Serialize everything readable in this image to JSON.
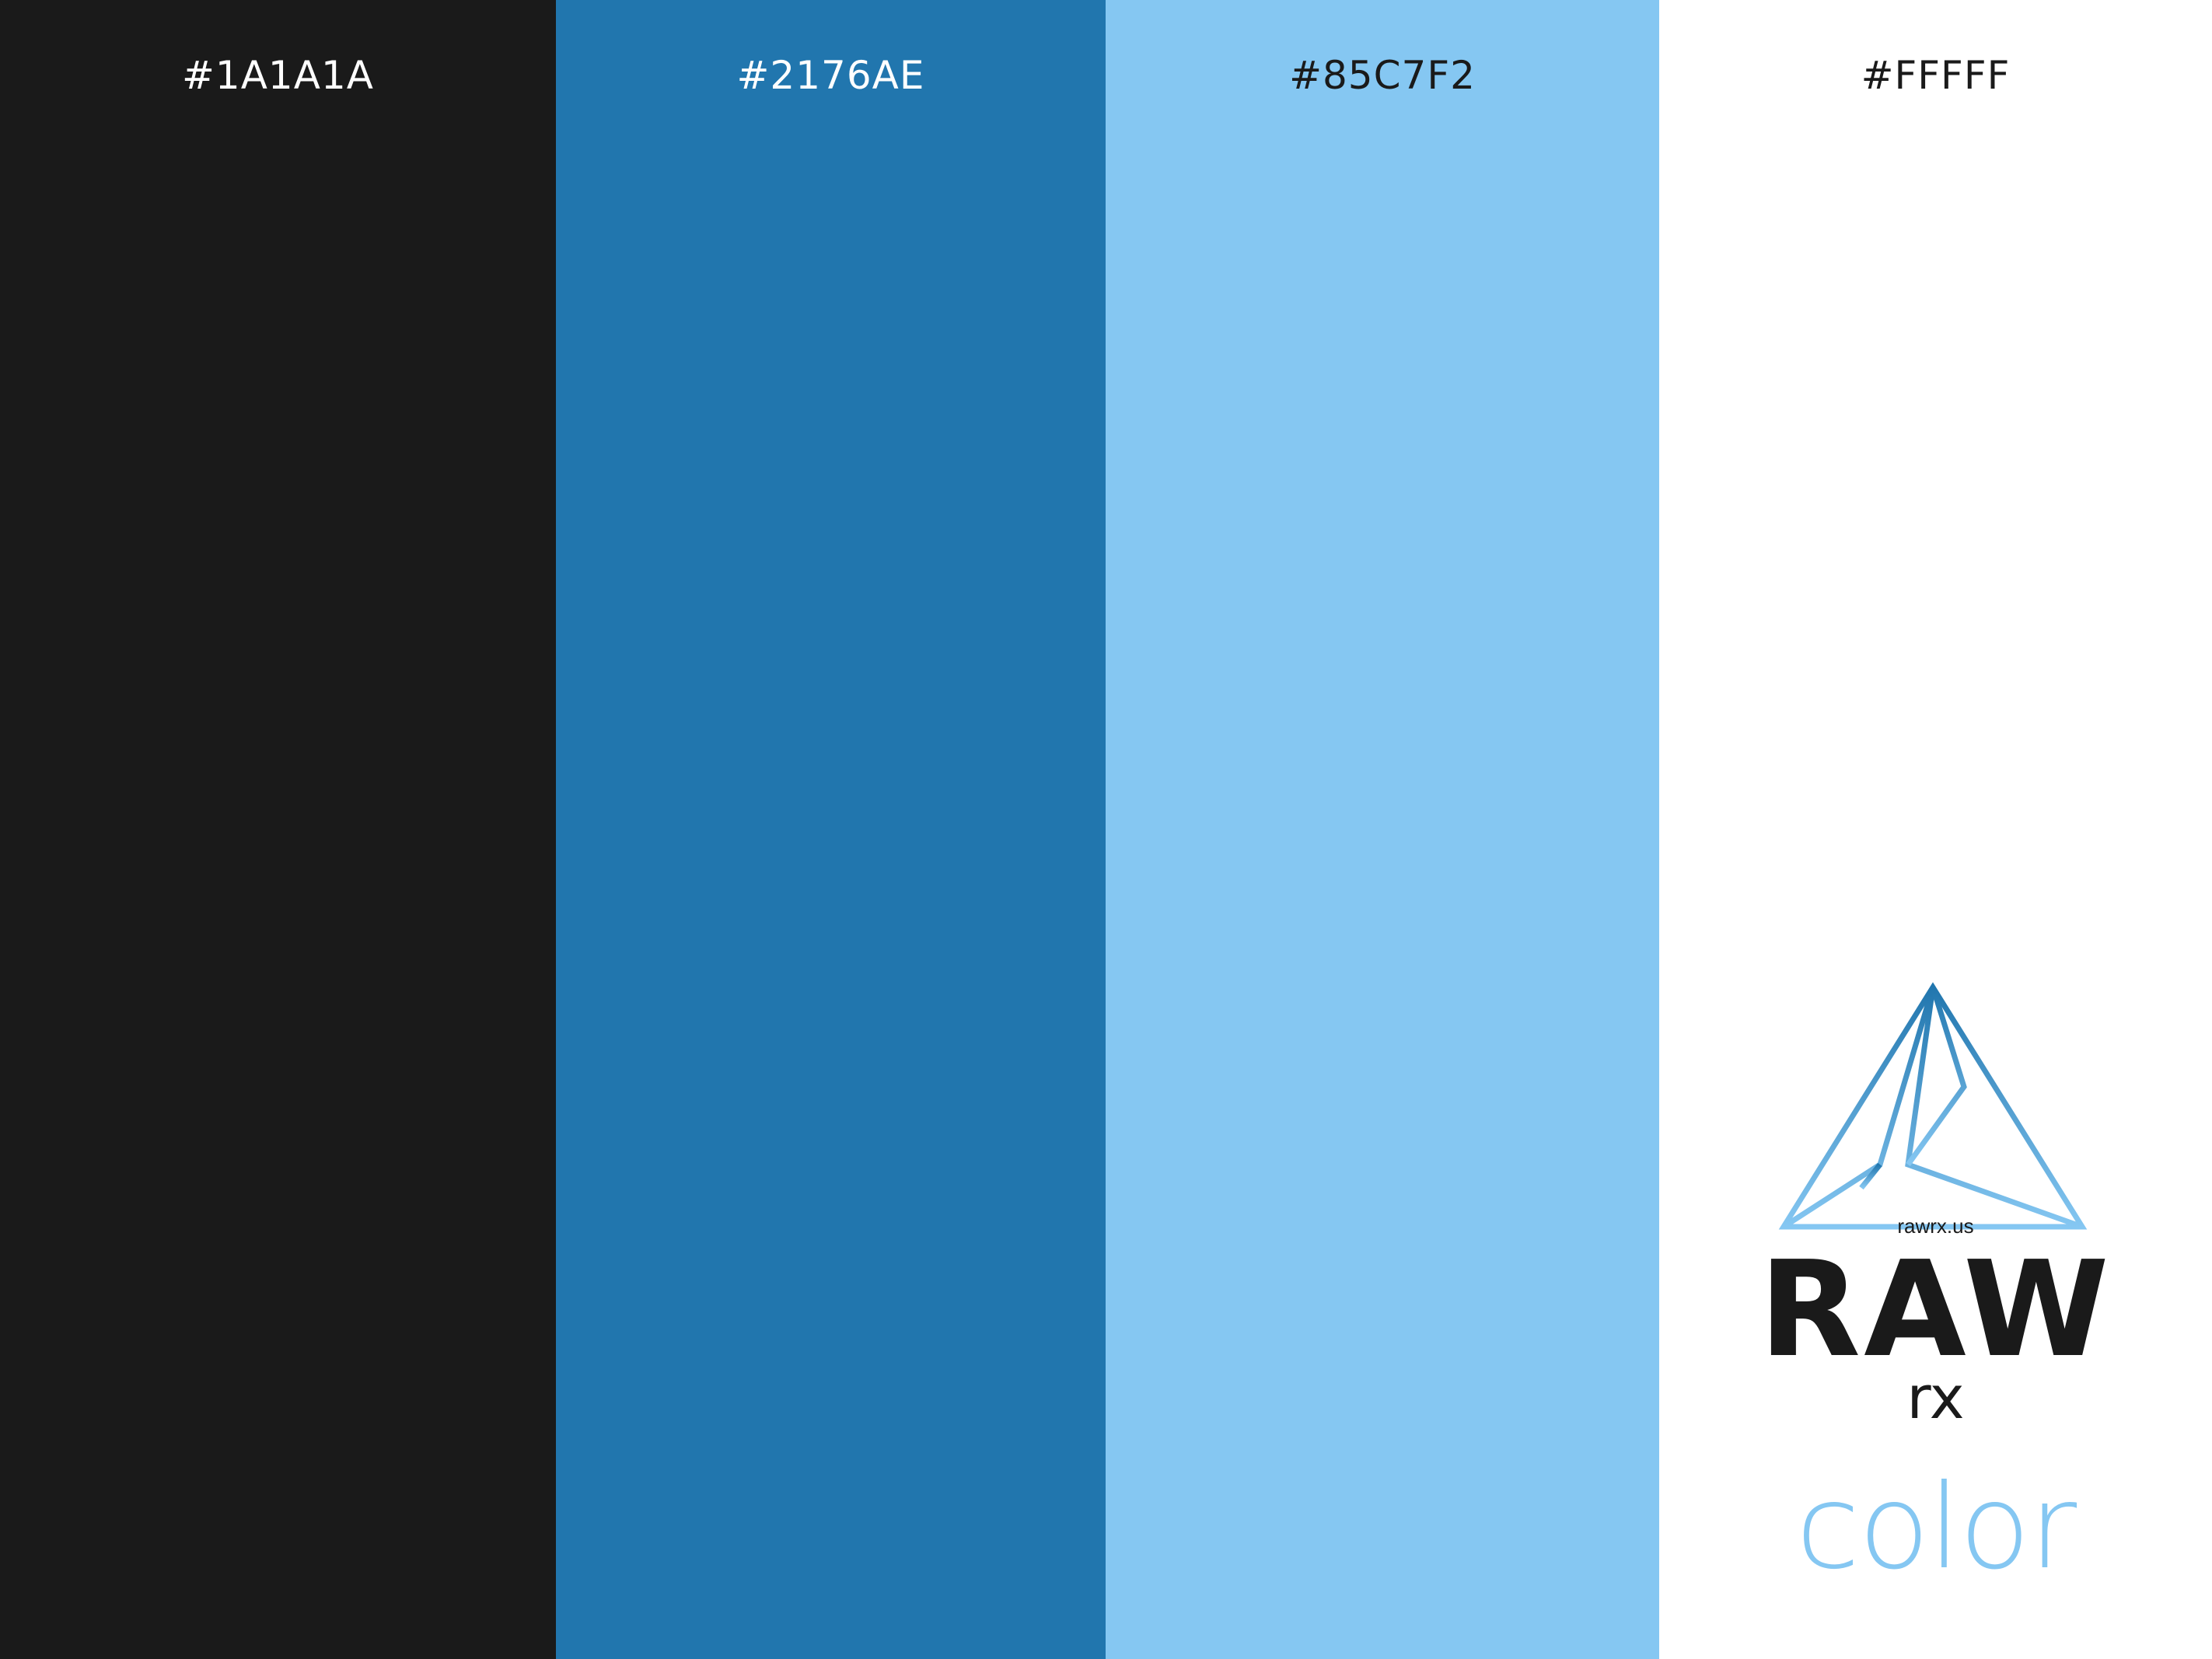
{
  "swatches": [
    {
      "hex": "#1A1A1A",
      "label": "#1A1A1A"
    },
    {
      "hex": "#2176AE",
      "label": "#2176AE"
    },
    {
      "hex": "#85C7F2",
      "label": "#85C7F2"
    },
    {
      "hex": "#FFFFFF",
      "label": "#FFFFF"
    }
  ],
  "logo": {
    "url": "rawrx.us",
    "raw": "RAW",
    "rx": "rx",
    "tagline": "color",
    "mark_icon": "triangle-prism-icon",
    "mark_colors": {
      "top": "#2176AE",
      "bottom": "#85C7F2"
    }
  }
}
